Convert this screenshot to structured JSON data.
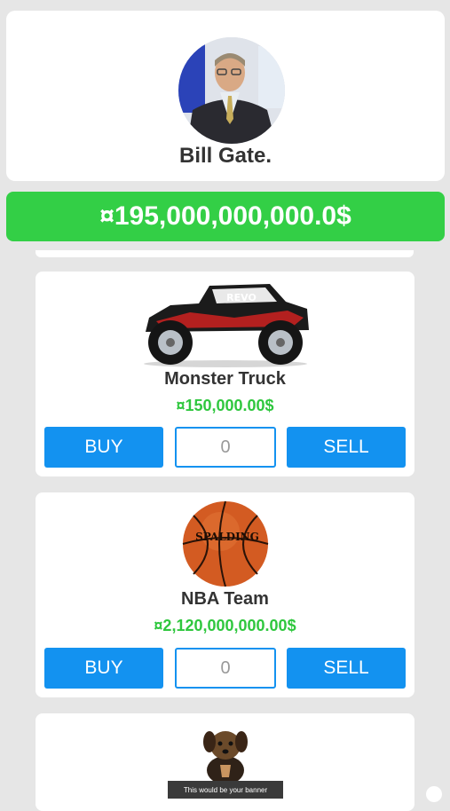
{
  "profile": {
    "name": "Bill Gate."
  },
  "balance": "¤195,000,000,000.0$",
  "items": [
    {
      "name": "Monster Truck",
      "price": "¤150,000.00$",
      "buy_label": "BUY",
      "sell_label": "SELL",
      "quantity": "0",
      "image": "monster-truck",
      "truck_decal": "REVO"
    },
    {
      "name": "NBA Team",
      "price": "¤2,120,000,000.00$",
      "buy_label": "BUY",
      "sell_label": "SELL",
      "quantity": "0",
      "image": "basketball",
      "ball_brand": "SPALDING"
    },
    {
      "image": "puppy"
    }
  ],
  "banner": "This would be your banner"
}
